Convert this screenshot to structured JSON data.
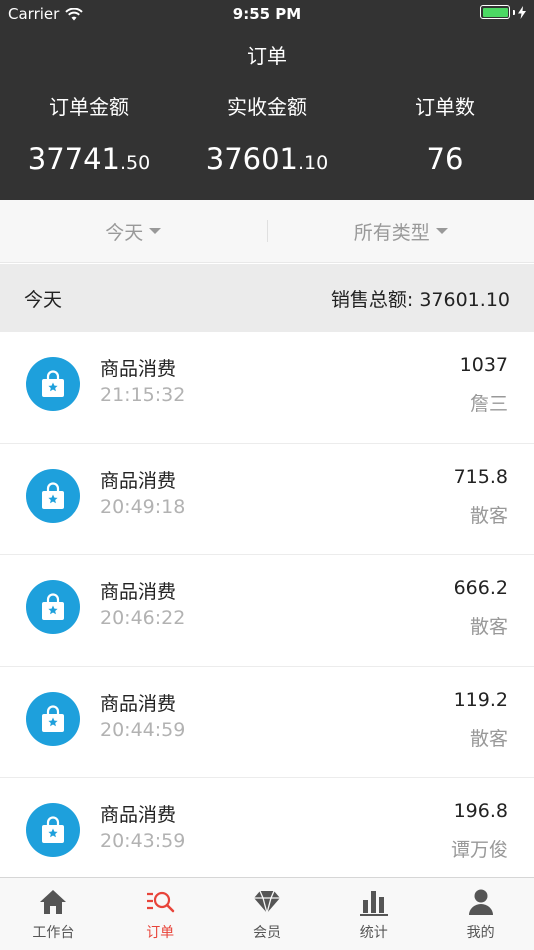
{
  "status_bar": {
    "carrier": "Carrier",
    "time": "9:55 PM"
  },
  "nav": {
    "title": "订单"
  },
  "stats": [
    {
      "label": "订单金额",
      "value_int": "37741",
      "value_dec": ".50"
    },
    {
      "label": "实收金额",
      "value_int": "37601",
      "value_dec": ".10"
    },
    {
      "label": "订单数",
      "value_int": "76",
      "value_dec": ""
    }
  ],
  "filters": {
    "date": "今天",
    "type": "所有类型"
  },
  "summary": {
    "period": "今天",
    "total_label": "销售总额: 37601.10"
  },
  "orders": [
    {
      "type": "商品消费",
      "time": "21:15:32",
      "amount": "1037",
      "customer": "詹三"
    },
    {
      "type": "商品消费",
      "time": "20:49:18",
      "amount": "715.8",
      "customer": "散客"
    },
    {
      "type": "商品消费",
      "time": "20:46:22",
      "amount": "666.2",
      "customer": "散客"
    },
    {
      "type": "商品消费",
      "time": "20:44:59",
      "amount": "119.2",
      "customer": "散客"
    },
    {
      "type": "商品消费",
      "time": "20:43:59",
      "amount": "196.8",
      "customer": "谭万俊"
    }
  ],
  "tabs": [
    {
      "label": "工作台",
      "icon": "home-icon"
    },
    {
      "label": "订单",
      "icon": "order-search-icon",
      "active": true
    },
    {
      "label": "会员",
      "icon": "diamond-icon"
    },
    {
      "label": "统计",
      "icon": "bar-chart-icon"
    },
    {
      "label": "我的",
      "icon": "person-icon"
    }
  ],
  "colors": {
    "header_bg": "#333333",
    "accent": "#e8443a",
    "order_icon_bg": "#1ea0dc",
    "battery": "#4cd964"
  }
}
